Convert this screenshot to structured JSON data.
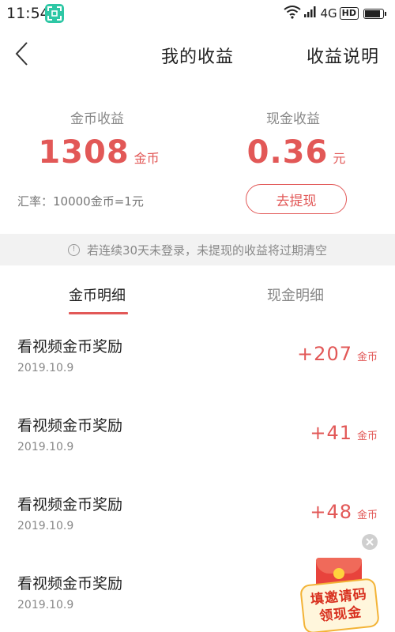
{
  "status_bar": {
    "time": "11:54",
    "network": "4G",
    "hd": "HD",
    "battery_level": 0.9
  },
  "nav": {
    "title": "我的收益",
    "help_label": "收益说明"
  },
  "summary": {
    "coin_label": "金币收益",
    "coin_amount": "1308",
    "coin_unit": "金币",
    "rate_text": "汇率：10000金币=1元",
    "cash_label": "现金收益",
    "cash_amount": "0.36",
    "cash_unit": "元",
    "withdraw_label": "去提现"
  },
  "notice": {
    "icon": "info-icon",
    "text": "若连续30天未登录，未提现的收益将过期清空"
  },
  "tabs": [
    {
      "label": "金币明细",
      "active": true
    },
    {
      "label": "现金明细",
      "active": false
    }
  ],
  "records": [
    {
      "title": "看视频金币奖励",
      "date": "2019.10.9",
      "amount": "+207",
      "unit": "金币"
    },
    {
      "title": "看视频金币奖励",
      "date": "2019.10.9",
      "amount": "+41",
      "unit": "金币"
    },
    {
      "title": "看视频金币奖励",
      "date": "2019.10.9",
      "amount": "+48",
      "unit": "金币"
    },
    {
      "title": "看视频金币奖励",
      "date": "2019.10.9",
      "amount": "",
      "unit": ""
    }
  ],
  "promo": {
    "line1": "填邀请码",
    "line2": "领现金"
  },
  "colors": {
    "accent": "#e25857",
    "notice_bg": "#f2f2f2",
    "status_app": "#2ec7a5"
  }
}
